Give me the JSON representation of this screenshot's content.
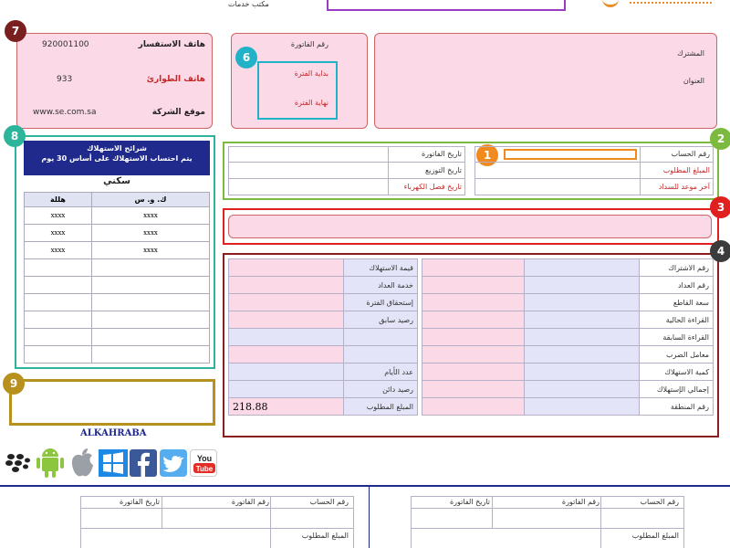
{
  "header": {
    "top_label": "مكتب خدمات"
  },
  "contact": {
    "inquiry_label": "هاتف الاستفسار",
    "inquiry_value": "920001100",
    "emergency_label": "هاتف الطوارئ",
    "emergency_value": "933",
    "website_label": "موقع الشركة",
    "website_value": "www.se.com.sa"
  },
  "invoice_period": {
    "invoice_number": "رقم الفاتورة",
    "period_start": "بداية الفترة",
    "period_end": "نهاية الفترة"
  },
  "subscriber": {
    "name_label": "المشترك",
    "address_label": "العنوان"
  },
  "account": {
    "account_number": "رقم الحساب",
    "amount_due": "المبلغ المطلوب",
    "last_payment_date": "آخر موعد للسداد",
    "invoice_date": "تاريخ الفاتورة",
    "distribution_date": "تاريخ التوزيع",
    "disconnect_date": "تاريخ فصل الكهرباء"
  },
  "tariff": {
    "title_line1": "شرائح الاستهلاك",
    "title_line2": "يتم احتساب الاستهلاك على أساس 30 يوم",
    "category": "سكني",
    "col_kwh": "ك. و. س",
    "col_halala": "هللة",
    "rows": [
      [
        "xxxx",
        "xxxx"
      ],
      [
        "xxxx",
        "xxxx"
      ],
      [
        "xxxx",
        "xxxx"
      ]
    ]
  },
  "details_right": {
    "labels": [
      "رقم الاشتراك",
      "رقم العداد",
      "سعة القاطع",
      "القراءة الحالية",
      "القراءة السابقة",
      "معامل الضرب",
      "كمية الاستهلاك",
      "إجمالي الإستهلاك",
      "رقم المنطقة"
    ]
  },
  "details_left": {
    "labels": [
      "قيمة الاستهلاك",
      "خدمة العداد",
      "إستحقاق الفترة",
      "رصيد سابق",
      "",
      "",
      "عدد الأيام",
      "رصيد دائن",
      "المبلغ المطلوب"
    ],
    "amount_value": "218.88"
  },
  "brand": {
    "name": "ALKAHRABA"
  },
  "badges": {
    "b1": "1",
    "b2": "2",
    "b3": "3",
    "b4": "4",
    "b6": "6",
    "b7": "7",
    "b8": "8",
    "b9": "9"
  },
  "colors": {
    "badge1": "#f0891e",
    "badge2": "#7cba3f",
    "badge3": "#e0201f",
    "badge4": "#3c3c3c",
    "badge6": "#22b2c8",
    "badge7": "#7a1f1f",
    "badge8": "#2cb59a",
    "badge9": "#b8901d",
    "purple": "#9b3bc4"
  },
  "stub": {
    "account_number": "رقم الحساب",
    "invoice_number": "رقم الفاتورة",
    "invoice_date": "تاريخ الفاتورة",
    "amount_due": "المبلغ المطلوب"
  },
  "icons": [
    "blackberry-icon",
    "android-icon",
    "apple-icon",
    "windows-icon",
    "facebook-icon",
    "twitter-icon",
    "youtube-icon"
  ]
}
